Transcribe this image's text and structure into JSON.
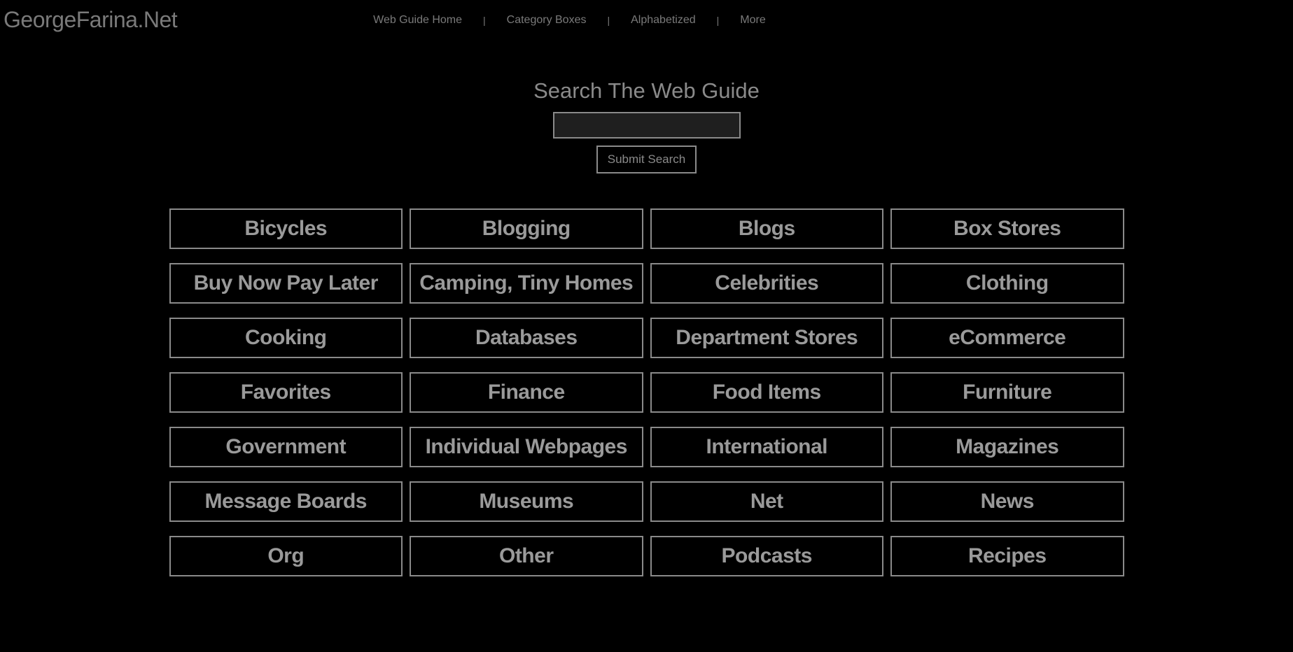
{
  "header": {
    "logo": "GeorgeFarina.Net",
    "nav": [
      "Web Guide Home",
      "Category Boxes",
      "Alphabetized",
      "More"
    ]
  },
  "search": {
    "title": "Search The Web Guide",
    "button": "Submit Search"
  },
  "categories": [
    "Bicycles",
    "Blogging",
    "Blogs",
    "Box Stores",
    "Buy Now Pay Later",
    "Camping, Tiny Homes",
    "Celebrities",
    "Clothing",
    "Cooking",
    "Databases",
    "Department Stores",
    "eCommerce",
    "Favorites",
    "Finance",
    "Food Items",
    "Furniture",
    "Government",
    "Individual Webpages",
    "International",
    "Magazines",
    "Message Boards",
    "Museums",
    "Net",
    "News",
    "Org",
    "Other",
    "Podcasts",
    "Recipes"
  ]
}
